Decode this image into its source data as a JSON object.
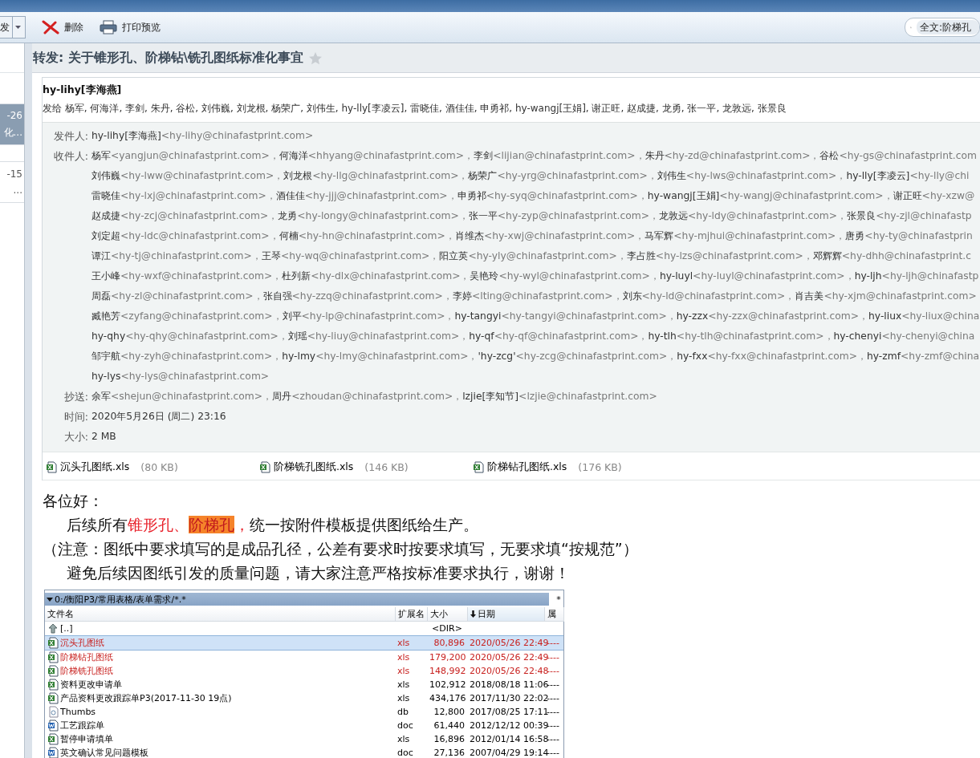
{
  "toolbar": {
    "forward_label": "发",
    "buttons": [
      {
        "kind": "delete",
        "label": "删除"
      },
      {
        "kind": "print",
        "label": "打印预览"
      }
    ],
    "search": {
      "value": "全文:阶梯孔"
    }
  },
  "message_list": [
    {
      "date": "-26",
      "subject": "化...",
      "selected": true
    },
    {
      "date": "-15",
      "subject": "...",
      "selected": false
    }
  ],
  "subject": "转发: 关于锥形孔、阶梯钻\\铣孔图纸标准化事宜",
  "starred": false,
  "sender": "hy-lihy[李海燕]",
  "sent_to": "发给 杨军, 何海洋, 李剑, 朱丹, 谷松, 刘伟巍, 刘龙根, 杨荣广, 刘伟生, hy-lly[李凌云], 雷晓佳, 酒佳佳, 申勇祁, hy-wangj[王娟], 谢正旺, 赵成捷, 龙勇, 张一平, 龙敦远, 张景良",
  "details": [
    {
      "label": "发件人:",
      "lines": [
        [
          {
            "name": "hy-lihy[李海燕]",
            "address": "<hy-lihy@chinafastprint.com>"
          }
        ]
      ]
    },
    {
      "label": "收件人:",
      "lines": [
        [
          {
            "name": "杨军",
            "address": "<yangjun@chinafastprint.com>，"
          },
          {
            "name": "何海洋",
            "address": "<hhyang@chinafastprint.com>，"
          },
          {
            "name": "李剑",
            "address": "<lijian@chinafastprint.com>，"
          },
          {
            "name": "朱丹",
            "address": "<hy-zd@chinafastprint.com>，"
          },
          {
            "name": "谷松",
            "address": "<hy-gs@chinafastprint.com"
          }
        ],
        [
          {
            "name": "刘伟巍",
            "address": "<hy-lww@chinafastprint.com>，"
          },
          {
            "name": "刘龙根",
            "address": "<hy-llg@chinafastprint.com>，"
          },
          {
            "name": "杨荣广",
            "address": "<hy-yrg@chinafastprint.com>，"
          },
          {
            "name": "刘伟生",
            "address": "<hy-lws@chinafastprint.com>，"
          },
          {
            "name": "hy-lly[李凌云]",
            "address": "<hy-lly@chi"
          }
        ],
        [
          {
            "name": "雷晓佳",
            "address": "<hy-lxj@chinafastprint.com>，"
          },
          {
            "name": "酒佳佳",
            "address": "<hy-jjj@chinafastprint.com>，"
          },
          {
            "name": "申勇祁",
            "address": "<hy-syq@chinafastprint.com>，"
          },
          {
            "name": "hy-wangj[王娟]",
            "address": "<hy-wangj@chinafastprint.com>，"
          },
          {
            "name": "谢正旺",
            "address": "<hy-xzw@"
          }
        ],
        [
          {
            "name": "赵成捷",
            "address": "<hy-zcj@chinafastprint.com>，"
          },
          {
            "name": "龙勇",
            "address": "<hy-longy@chinafastprint.com>，"
          },
          {
            "name": "张一平",
            "address": "<hy-zyp@chinafastprint.com>，"
          },
          {
            "name": "龙敦远",
            "address": "<hy-ldy@chinafastprint.com>，"
          },
          {
            "name": "张景良",
            "address": "<hy-zjl@chinafastp"
          }
        ],
        [
          {
            "name": "刘定超",
            "address": "<hy-ldc@chinafastprint.com>，"
          },
          {
            "name": "何楠",
            "address": "<hy-hn@chinafastprint.com>，"
          },
          {
            "name": "肖维杰",
            "address": "<hy-xwj@chinafastprint.com>，"
          },
          {
            "name": "马军辉",
            "address": "<hy-mjhui@chinafastprint.com>，"
          },
          {
            "name": "唐勇",
            "address": "<hy-ty@chinafastprin"
          }
        ],
        [
          {
            "name": "谭江",
            "address": "<hy-tj@chinafastprint.com>，"
          },
          {
            "name": "王琴",
            "address": "<hy-wq@chinafastprint.com>，"
          },
          {
            "name": "阳立英",
            "address": "<hy-yly@chinafastprint.com>，"
          },
          {
            "name": "李占胜",
            "address": "<hy-lzs@chinafastprint.com>，"
          },
          {
            "name": "邓辉辉",
            "address": "<hy-dhh@chinafastprint.c"
          }
        ],
        [
          {
            "name": "王小峰",
            "address": "<hy-wxf@chinafastprint.com>，"
          },
          {
            "name": "杜列新",
            "address": "<hy-dlx@chinafastprint.com>，"
          },
          {
            "name": "吴艳玲",
            "address": "<hy-wyl@chinafastprint.com>，"
          },
          {
            "name": "hy-luyl",
            "address": "<hy-luyl@chinafastprint.com>，"
          },
          {
            "name": "hy-ljh",
            "address": "<hy-ljh@chinafastp"
          }
        ],
        [
          {
            "name": "周磊",
            "address": "<hy-zl@chinafastprint.com>，"
          },
          {
            "name": "张自强",
            "address": "<hy-zzq@chinafastprint.com>，"
          },
          {
            "name": "李婷",
            "address": "<lting@chinafastprint.com>，"
          },
          {
            "name": "刘东",
            "address": "<hy-ld@chinafastprint.com>，"
          },
          {
            "name": "肖吉美",
            "address": "<hy-xjm@chinafastprint.com>"
          }
        ],
        [
          {
            "name": "臧艳芳",
            "address": "<zyfang@chinafastprint.com>，"
          },
          {
            "name": "刘平",
            "address": "<hy-lp@chinafastprint.com>，"
          },
          {
            "name": "hy-tangyi",
            "address": "<hy-tangyi@chinafastprint.com>，"
          },
          {
            "name": "hy-zzx",
            "address": "<hy-zzx@chinafastprint.com>，"
          },
          {
            "name": "hy-liux",
            "address": "<hy-liux@china"
          }
        ],
        [
          {
            "name": "hy-qhy",
            "address": "<hy-qhy@chinafastprint.com>，"
          },
          {
            "name": "刘瑶",
            "address": "<hy-liuy@chinafastprint.com>，"
          },
          {
            "name": "hy-qf",
            "address": "<hy-qf@chinafastprint.com>，"
          },
          {
            "name": "hy-tlh",
            "address": "<hy-tlh@chinafastprint.com>，"
          },
          {
            "name": "hy-chenyi",
            "address": "<hy-chenyi@china"
          }
        ],
        [
          {
            "name": "邹宇航",
            "address": "<hy-zyh@chinafastprint.com>，"
          },
          {
            "name": "hy-lmy",
            "address": "<hy-lmy@chinafastprint.com>，"
          },
          {
            "name": "'hy-zcg'",
            "address": "<hy-zcg@chinafastprint.com>，"
          },
          {
            "name": "hy-fxx",
            "address": "<hy-fxx@chinafastprint.com>，"
          },
          {
            "name": "hy-zmf",
            "address": "<hy-zmf@china"
          }
        ],
        [
          {
            "name": "hy-lys",
            "address": "<hy-lys@chinafastprint.com>"
          }
        ]
      ]
    },
    {
      "label": "抄送:",
      "lines": [
        [
          {
            "name": "余军",
            "address": "<shejun@chinafastprint.com>，"
          },
          {
            "name": "周丹",
            "address": "<zhoudan@chinafastprint.com>，"
          },
          {
            "name": "lzjie[李知节]",
            "address": "<lzjie@chinafastprint.com>"
          }
        ]
      ]
    },
    {
      "label": "时间:",
      "lines": [
        [
          {
            "name": "2020年5月26日 (周二) 23:16"
          }
        ]
      ]
    },
    {
      "label": "大小:",
      "lines": [
        [
          {
            "name": "2 MB"
          }
        ]
      ]
    }
  ],
  "attachments": [
    {
      "name": "沉头孔图纸.xls",
      "size": "(80 KB)"
    },
    {
      "name": "阶梯铣孔图纸.xls",
      "size": "(146 KB)"
    },
    {
      "name": "阶梯钻孔图纸.xls",
      "size": "(176 KB)"
    }
  ],
  "body": [
    {
      "indent": false,
      "segments": [
        {
          "kind": "plain",
          "text": "各位好："
        }
      ]
    },
    {
      "indent": true,
      "segments": [
        {
          "kind": "plain",
          "text": "后续所有"
        },
        {
          "kind": "red",
          "text": "锥形孔、"
        },
        {
          "kind": "highlight",
          "text": "阶梯孔"
        },
        {
          "kind": "red",
          "text": "，"
        },
        {
          "kind": "plain",
          "text": "统一按附件模板提供图纸给生产。"
        }
      ]
    },
    {
      "indent": false,
      "segments": [
        {
          "kind": "plain",
          "text": "（注意：图纸中要求填写的是成品孔径，公差有要求时按要求填写，无要求填“按规范”）"
        }
      ]
    },
    {
      "indent": true,
      "segments": [
        {
          "kind": "plain",
          "text": "避免后续因图纸引发的质量问题，请大家注意严格按标准要求执行，谢谢！"
        }
      ]
    }
  ],
  "file_manager": {
    "path": "0:/衡阳P3/常用表格/表单需求/*.*",
    "corner_mark": "*",
    "columns": [
      "文件名",
      "扩展名",
      "大小",
      "日期",
      "属"
    ],
    "rows": [
      {
        "kind": "up",
        "name": "[..]",
        "size": "<DIR>",
        "selected": false,
        "color": "#000000"
      },
      {
        "kind": "xls",
        "name": "沉头孔图纸",
        "ext": "xls",
        "size": "80,896",
        "date": "2020/05/26 22:49",
        "attr": "----",
        "selected": true,
        "color": "#c8201e"
      },
      {
        "kind": "xls",
        "name": "阶梯钻孔图纸",
        "ext": "xls",
        "size": "179,200",
        "date": "2020/05/26 22:49",
        "attr": "----",
        "selected": false,
        "color": "#c8201e"
      },
      {
        "kind": "xls",
        "name": "阶梯铣孔图纸",
        "ext": "xls",
        "size": "148,992",
        "date": "2020/05/26 22:48",
        "attr": "----",
        "selected": false,
        "color": "#c8201e"
      },
      {
        "kind": "xls",
        "name": "资料更改申请单",
        "ext": "xls",
        "size": "102,912",
        "date": "2018/08/18 11:06",
        "attr": "----",
        "selected": false,
        "color": "#000000"
      },
      {
        "kind": "xls",
        "name": "产品资料更改跟踪单P3(2017-11-30 19点)",
        "ext": "xls",
        "size": "434,176",
        "date": "2017/11/30 22:02",
        "attr": "----",
        "selected": false,
        "color": "#000000"
      },
      {
        "kind": "db",
        "name": "Thumbs",
        "ext": "db",
        "size": "12,800",
        "date": "2017/08/25 17:11",
        "attr": "----",
        "selected": false,
        "color": "#000000"
      },
      {
        "kind": "doc",
        "name": "工艺跟踪单",
        "ext": "doc",
        "size": "61,440",
        "date": "2012/12/12 00:39",
        "attr": "----",
        "selected": false,
        "color": "#000000"
      },
      {
        "kind": "xls",
        "name": "暂停申请填单",
        "ext": "xls",
        "size": "16,896",
        "date": "2012/01/14 16:58",
        "attr": "----",
        "selected": false,
        "color": "#000000"
      },
      {
        "kind": "doc",
        "name": "英文确认常见问题模板",
        "ext": "doc",
        "size": "27,136",
        "date": "2007/04/29 19:14",
        "attr": "----",
        "selected": false,
        "color": "#000000"
      }
    ]
  }
}
